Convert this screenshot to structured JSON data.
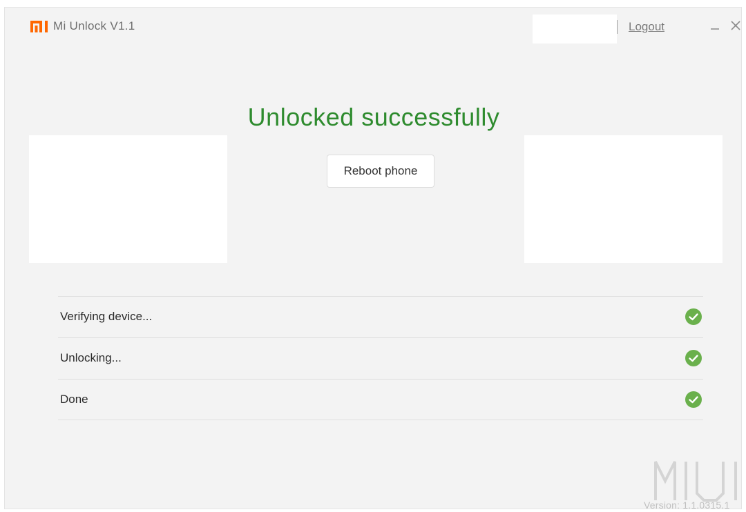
{
  "window": {
    "logo_text": "mi",
    "app_title": "Mi Unlock  V1.1",
    "logout_label": "Logout",
    "minimize_symbol": "–",
    "close_symbol": "✕"
  },
  "main": {
    "headline": "Unlocked successfully",
    "reboot_label": "Reboot phone"
  },
  "steps": [
    {
      "label": "Verifying device...",
      "status": "done"
    },
    {
      "label": "Unlocking...",
      "status": "done"
    },
    {
      "label": "Done",
      "status": "done"
    }
  ],
  "footer": {
    "watermark": "MIUI",
    "version": "Version: 1.1.0315.1"
  },
  "colors": {
    "brand_orange": "#ff6700",
    "success_green": "#2e8b2e",
    "check_green": "#6ab04c"
  },
  "icons": {
    "logo": "mi-logo-icon",
    "minimize": "minimize-icon",
    "close": "close-icon",
    "step_status": "check-circle-icon"
  }
}
